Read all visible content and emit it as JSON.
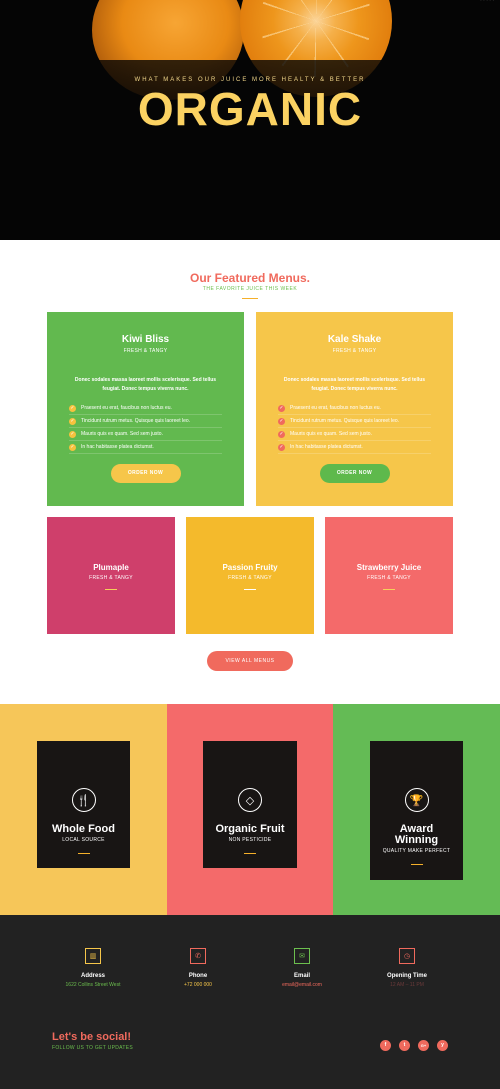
{
  "hero": {
    "top_links": "· · · · ·",
    "kicker": "WHAT MAKES OUR JUICE MORE HEALTY & BETTER",
    "title": "ORGANIC"
  },
  "menus": {
    "title": "Our Featured Menus.",
    "subtitle": "THE FAVORITE JUICE THIS WEEK",
    "featured": [
      {
        "name": "Kiwi Bliss",
        "tagline": "FRESH & TANGY",
        "description": "Donec sodales massa laoreet mollis scelerisque. Sed tellus feugiat. Donec tempus viverra nunc.",
        "items": [
          "Praesent eu erat, faucibus non luctus eu.",
          "Tincidunt rutrum metus. Quisque quis laoreet leo.",
          "Mauris quis ex quam. Sed sem justo.",
          "In hac habitasse platea dictumst."
        ],
        "button": "ORDER NOW",
        "bg": "#62b94f",
        "button_bg": "#f6c64a"
      },
      {
        "name": "Kale Shake",
        "tagline": "FRESH & TANGY",
        "description": "Donec sodales massa laoreet mollis scelerisque. Sed tellus feugiat. Donec tempus viverra nunc.",
        "items": [
          "Praesent eu erat, faucibus non luctus eu.",
          "Tincidunt rutrum metus. Quisque quis laoreet leo.",
          "Mauris quis ex quam. Sed sem justo.",
          "In hac habitasse platea dictumst."
        ],
        "button": "ORDER NOW",
        "bg": "#f6c64a",
        "button_bg": "#5eb94c"
      }
    ],
    "small": [
      {
        "name": "Plumaple",
        "tagline": "FRESH & TANGY",
        "bg": "#cf3f6b"
      },
      {
        "name": "Passion Fruity",
        "tagline": "FRESH & TANGY",
        "bg": "#f4ba2c"
      },
      {
        "name": "Strawberry Juice",
        "tagline": "FRESH & TANGY",
        "bg": "#f46a6a"
      }
    ],
    "view_all": "VIEW ALL MENUS"
  },
  "features": [
    {
      "icon": "cutlery-icon",
      "glyph": "🍴",
      "title": "Whole Food",
      "subtitle": "LOCAL SOURCE",
      "bg": "#f6c659"
    },
    {
      "icon": "diamond-icon",
      "glyph": "◇",
      "title": "Organic Fruit",
      "subtitle": "NON PESTICIDE",
      "bg": "#f46a6a"
    },
    {
      "icon": "trophy-icon",
      "glyph": "🏆",
      "title": "Award Winning",
      "subtitle": "QUALITY MAKE PERFECT",
      "bg": "#64bb55"
    }
  ],
  "contact": [
    {
      "icon": "building-icon",
      "glyph": "▥",
      "label": "Address",
      "value": "1622 Collins Street West",
      "color": "#f6c64a",
      "value_color": "#6cbf4e"
    },
    {
      "icon": "phone-icon",
      "glyph": "✆",
      "label": "Phone",
      "value": "+72 000 000",
      "color": "#f06a5d",
      "value_color": "#f6c64a"
    },
    {
      "icon": "mail-icon",
      "glyph": "✉",
      "label": "Email",
      "value": "email@email.com",
      "color": "#6cbf4e",
      "value_color": "#f06a5d"
    },
    {
      "icon": "clock-icon",
      "glyph": "◷",
      "label": "Opening Time",
      "value": "12 AM – 11 PM",
      "color": "#f06a5d",
      "value_color": "#6b3a3a"
    }
  ],
  "social": {
    "title": "Let's be social!",
    "subtitle": "FOLLOW US TO GET UPDATES",
    "links": [
      {
        "icon": "facebook-icon",
        "glyph": "f"
      },
      {
        "icon": "twitter-icon",
        "glyph": "t"
      },
      {
        "icon": "google-plus-icon",
        "glyph": "G+"
      },
      {
        "icon": "yelp-icon",
        "glyph": "y"
      }
    ]
  }
}
